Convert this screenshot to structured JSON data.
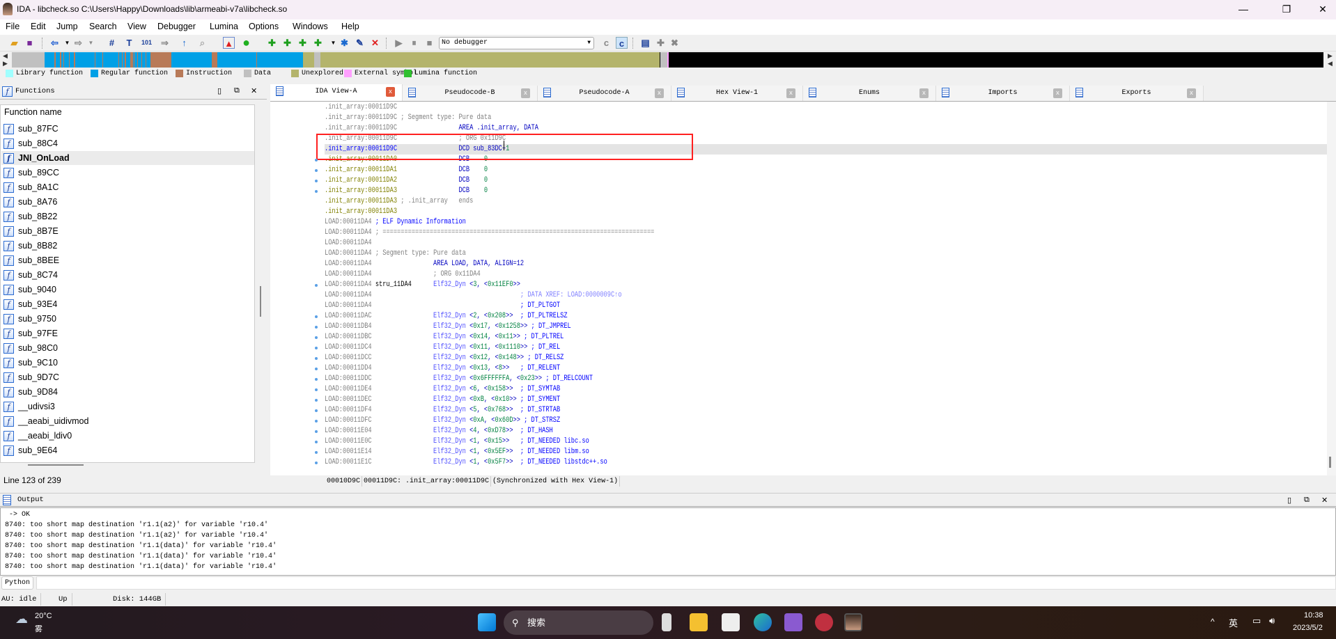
{
  "window": {
    "title": "IDA - libcheck.so C:\\Users\\Happy\\Downloads\\lib\\armeabi-v7a\\libcheck.so",
    "controls": [
      "—",
      "❐",
      "✕"
    ]
  },
  "menu": [
    "File",
    "Edit",
    "Jump",
    "Search",
    "View",
    "Debugger",
    "Lumina",
    "Options",
    "Windows",
    "Help"
  ],
  "toolbar": {
    "debugger_select": "No debugger"
  },
  "legend": [
    {
      "label": "Library function",
      "color": "#a0ffff"
    },
    {
      "label": "Regular function",
      "color": "#00a0e6"
    },
    {
      "label": "Instruction",
      "color": "#b87a58"
    },
    {
      "label": "Data",
      "color": "#c0c0c0"
    },
    {
      "label": "Unexplored",
      "color": "#b4b46c"
    },
    {
      "label": "External symbol",
      "color": "#ffa0ff"
    },
    {
      "label": "Lumina function",
      "color": "#30c030"
    }
  ],
  "functions": {
    "title": "Functions",
    "column": "Function name",
    "items": [
      "sub_87FC",
      "sub_88C4",
      "JNI_OnLoad",
      "sub_89CC",
      "sub_8A1C",
      "sub_8A76",
      "sub_8B22",
      "sub_8B7E",
      "sub_8B82",
      "sub_8BEE",
      "sub_8C74",
      "sub_9040",
      "sub_93E4",
      "sub_9750",
      "sub_97FE",
      "sub_98C0",
      "sub_9C10",
      "sub_9D7C",
      "sub_9D84",
      "__udivsi3",
      "__aeabi_uidivmod",
      "__aeabi_ldiv0",
      "sub_9E64"
    ],
    "selected": "JNI_OnLoad",
    "status": "Line 123 of 239"
  },
  "tabs": [
    {
      "label": "IDA View-A",
      "active": true
    },
    {
      "label": "Pseudocode-B"
    },
    {
      "label": "Pseudocode-A"
    },
    {
      "label": "Hex View-1"
    },
    {
      "label": "Enums"
    },
    {
      "label": "Imports"
    },
    {
      "label": "Exports"
    }
  ],
  "code": [
    {
      "addr": ".init_array:00011D9C",
      "ac": "gray",
      "parts": []
    },
    {
      "addr": ".init_array:00011D9C",
      "ac": "gray",
      "parts": [
        {
          "col": 21,
          "t": "; Segment type: Pure data",
          "c": "gray"
        }
      ]
    },
    {
      "addr": ".init_array:00011D9C",
      "ac": "gray",
      "parts": [
        {
          "col": 37,
          "t": "AREA .init_array, DATA",
          "c": "navy"
        }
      ]
    },
    {
      "addr": ".init_array:00011D9C",
      "ac": "gray",
      "parts": [
        {
          "col": 37,
          "t": "; ORG 0x11D9C",
          "c": "gray"
        }
      ]
    },
    {
      "addr": ".init_array:00011D9C",
      "ac": "addrsel",
      "selected": true,
      "parts": [
        {
          "col": 37,
          "t": "DCD sub_83DC+1",
          "c": "code"
        }
      ]
    },
    {
      "addr": ".init_array:00011DA0",
      "ac": "olive",
      "dot": true,
      "parts": [
        {
          "col": 37,
          "t": "DCB    0",
          "c": "code"
        }
      ]
    },
    {
      "addr": ".init_array:00011DA1",
      "ac": "olive",
      "dot": true,
      "parts": [
        {
          "col": 37,
          "t": "DCB    0",
          "c": "code"
        }
      ]
    },
    {
      "addr": ".init_array:00011DA2",
      "ac": "olive",
      "dot": true,
      "parts": [
        {
          "col": 37,
          "t": "DCB    0",
          "c": "code"
        }
      ]
    },
    {
      "addr": ".init_array:00011DA3",
      "ac": "olive",
      "dot": true,
      "parts": [
        {
          "col": 37,
          "t": "DCB    0",
          "c": "code"
        }
      ]
    },
    {
      "addr": ".init_array:00011DA3",
      "ac": "olive",
      "parts": [
        {
          "col": 21,
          "t": "; .init_array",
          "c": "gray"
        },
        {
          "col": 37,
          "t": "ends",
          "c": "gray"
        }
      ]
    },
    {
      "addr": ".init_array:00011DA3",
      "ac": "olive",
      "parts": []
    },
    {
      "addr": "LOAD:00011DA4",
      "ac": "gray",
      "parts": [
        {
          "col": 14,
          "t": "; ELF Dynamic Information",
          "c": "blue"
        }
      ]
    },
    {
      "addr": "LOAD:00011DA4",
      "ac": "gray",
      "parts": [
        {
          "col": 14,
          "t": "; ===========================================================================",
          "c": "gray"
        }
      ]
    },
    {
      "addr": "LOAD:00011DA4",
      "ac": "gray",
      "parts": []
    },
    {
      "addr": "LOAD:00011DA4",
      "ac": "gray",
      "parts": [
        {
          "col": 14,
          "t": "; Segment type: Pure data",
          "c": "gray"
        }
      ]
    },
    {
      "addr": "LOAD:00011DA4",
      "ac": "gray",
      "parts": [
        {
          "col": 30,
          "t": "AREA LOAD, DATA, ALIGN=12",
          "c": "navy"
        }
      ]
    },
    {
      "addr": "LOAD:00011DA4",
      "ac": "gray",
      "parts": [
        {
          "col": 30,
          "t": "; ORG 0x11DA4",
          "c": "gray"
        }
      ]
    },
    {
      "addr": "LOAD:00011DA4",
      "ac": "gray",
      "dot": true,
      "parts": [
        {
          "col": 14,
          "t": "stru_11DA4",
          "c": "black"
        },
        {
          "col": 30,
          "t": "Elf32_Dyn <3, <0x11EF0>>",
          "c": "code"
        }
      ]
    },
    {
      "addr": "LOAD:00011DA4",
      "ac": "gray",
      "parts": [
        {
          "col": 54,
          "t": "; DATA XREF: LOAD:0000009C↑o",
          "c": "xref"
        }
      ]
    },
    {
      "addr": "LOAD:00011DA4",
      "ac": "gray",
      "parts": [
        {
          "col": 54,
          "t": "; DT_PLTGOT",
          "c": "blue"
        }
      ]
    },
    {
      "addr": "LOAD:00011DAC",
      "ac": "gray",
      "dot": true,
      "parts": [
        {
          "col": 30,
          "t": "Elf32_Dyn <2, <0x208>>",
          "c": "code"
        },
        {
          "col": 54,
          "t": "; DT_PLTRELSZ",
          "c": "blue"
        }
      ]
    },
    {
      "addr": "LOAD:00011DB4",
      "ac": "gray",
      "dot": true,
      "parts": [
        {
          "col": 30,
          "t": "Elf32_Dyn <0x17, <0x1258>>",
          "c": "code"
        },
        {
          "col": 57,
          "t": "; DT_JMPREL",
          "c": "blue"
        }
      ]
    },
    {
      "addr": "LOAD:00011DBC",
      "ac": "gray",
      "dot": true,
      "parts": [
        {
          "col": 30,
          "t": "Elf32_Dyn <0x14, <0x11>>",
          "c": "code"
        },
        {
          "col": 55,
          "t": "; DT_PLTREL",
          "c": "blue"
        }
      ]
    },
    {
      "addr": "LOAD:00011DC4",
      "ac": "gray",
      "dot": true,
      "parts": [
        {
          "col": 30,
          "t": "Elf32_Dyn <0x11, <0x1110>>",
          "c": "code"
        },
        {
          "col": 57,
          "t": "; DT_REL",
          "c": "blue"
        }
      ]
    },
    {
      "addr": "LOAD:00011DCC",
      "ac": "gray",
      "dot": true,
      "parts": [
        {
          "col": 30,
          "t": "Elf32_Dyn <0x12, <0x148>>",
          "c": "code"
        },
        {
          "col": 56,
          "t": "; DT_RELSZ",
          "c": "blue"
        }
      ]
    },
    {
      "addr": "LOAD:00011DD4",
      "ac": "gray",
      "dot": true,
      "parts": [
        {
          "col": 30,
          "t": "Elf32_Dyn <0x13, <8>>",
          "c": "code"
        },
        {
          "col": 54,
          "t": "; DT_RELENT",
          "c": "blue"
        }
      ]
    },
    {
      "addr": "LOAD:00011DDC",
      "ac": "gray",
      "dot": true,
      "parts": [
        {
          "col": 30,
          "t": "Elf32_Dyn <0x6FFFFFFA, <0x23>>",
          "c": "code"
        },
        {
          "col": 61,
          "t": "; DT_RELCOUNT",
          "c": "blue"
        }
      ]
    },
    {
      "addr": "LOAD:00011DE4",
      "ac": "gray",
      "dot": true,
      "parts": [
        {
          "col": 30,
          "t": "Elf32_Dyn <6, <0x158>>",
          "c": "code"
        },
        {
          "col": 54,
          "t": "; DT_SYMTAB",
          "c": "blue"
        }
      ]
    },
    {
      "addr": "LOAD:00011DEC",
      "ac": "gray",
      "dot": true,
      "parts": [
        {
          "col": 30,
          "t": "Elf32_Dyn <0xB, <0x10>>",
          "c": "code"
        },
        {
          "col": 54,
          "t": "; DT_SYMENT",
          "c": "blue"
        }
      ]
    },
    {
      "addr": "LOAD:00011DF4",
      "ac": "gray",
      "dot": true,
      "parts": [
        {
          "col": 30,
          "t": "Elf32_Dyn <5, <0x768>>",
          "c": "code"
        },
        {
          "col": 54,
          "t": "; DT_STRTAB",
          "c": "blue"
        }
      ]
    },
    {
      "addr": "LOAD:00011DFC",
      "ac": "gray",
      "dot": true,
      "parts": [
        {
          "col": 30,
          "t": "Elf32_Dyn <0xA, <0x60D>>",
          "c": "code"
        },
        {
          "col": 55,
          "t": "; DT_STRSZ",
          "c": "blue"
        }
      ]
    },
    {
      "addr": "LOAD:00011E04",
      "ac": "gray",
      "dot": true,
      "parts": [
        {
          "col": 30,
          "t": "Elf32_Dyn <4, <0xD78>>",
          "c": "code"
        },
        {
          "col": 54,
          "t": "; DT_HASH",
          "c": "blue"
        }
      ]
    },
    {
      "addr": "LOAD:00011E0C",
      "ac": "gray",
      "dot": true,
      "parts": [
        {
          "col": 30,
          "t": "Elf32_Dyn <1, <0x15>>",
          "c": "code"
        },
        {
          "col": 54,
          "t": "; DT_NEEDED libc.so",
          "c": "blue"
        }
      ]
    },
    {
      "addr": "LOAD:00011E14",
      "ac": "gray",
      "dot": true,
      "parts": [
        {
          "col": 30,
          "t": "Elf32_Dyn <1, <0x5EF>>",
          "c": "code"
        },
        {
          "col": 54,
          "t": "; DT_NEEDED libm.so",
          "c": "blue"
        }
      ]
    },
    {
      "addr": "LOAD:00011E1C",
      "ac": "gray",
      "dot": true,
      "parts": [
        {
          "col": 30,
          "t": "Elf32_Dyn <1, <0x5F7>>",
          "c": "code"
        },
        {
          "col": 54,
          "t": "; DT_NEEDED libstdc++.so",
          "c": "blue"
        }
      ]
    }
  ],
  "view_status": [
    "00010D9C",
    "00011D9C: .init_array:00011D9C",
    "(Synchronized with Hex View-1)"
  ],
  "output": {
    "title": "Output",
    "lines": [
      " -> OK",
      "8740: too short map destination 'r1.1(a2)' for variable 'r10.4'",
      "8740: too short map destination 'r1.1(a2)' for variable 'r10.4'",
      "8740: too short map destination 'r1.1(data)' for variable 'r10.4'",
      "8740: too short map destination 'r1.1(data)' for variable 'r10.4'",
      "8740: too short map destination 'r1.1(data)' for variable 'r10.4'"
    ],
    "python_label": "Python"
  },
  "statusbar": {
    "au": "AU:  idle",
    "state": "Up",
    "disk": "Disk: 144GB"
  },
  "taskbar": {
    "temp": "20°C",
    "weather": "雾",
    "search": "搜索",
    "ime": "英",
    "time": "10:38",
    "date": "2023/5/2"
  }
}
